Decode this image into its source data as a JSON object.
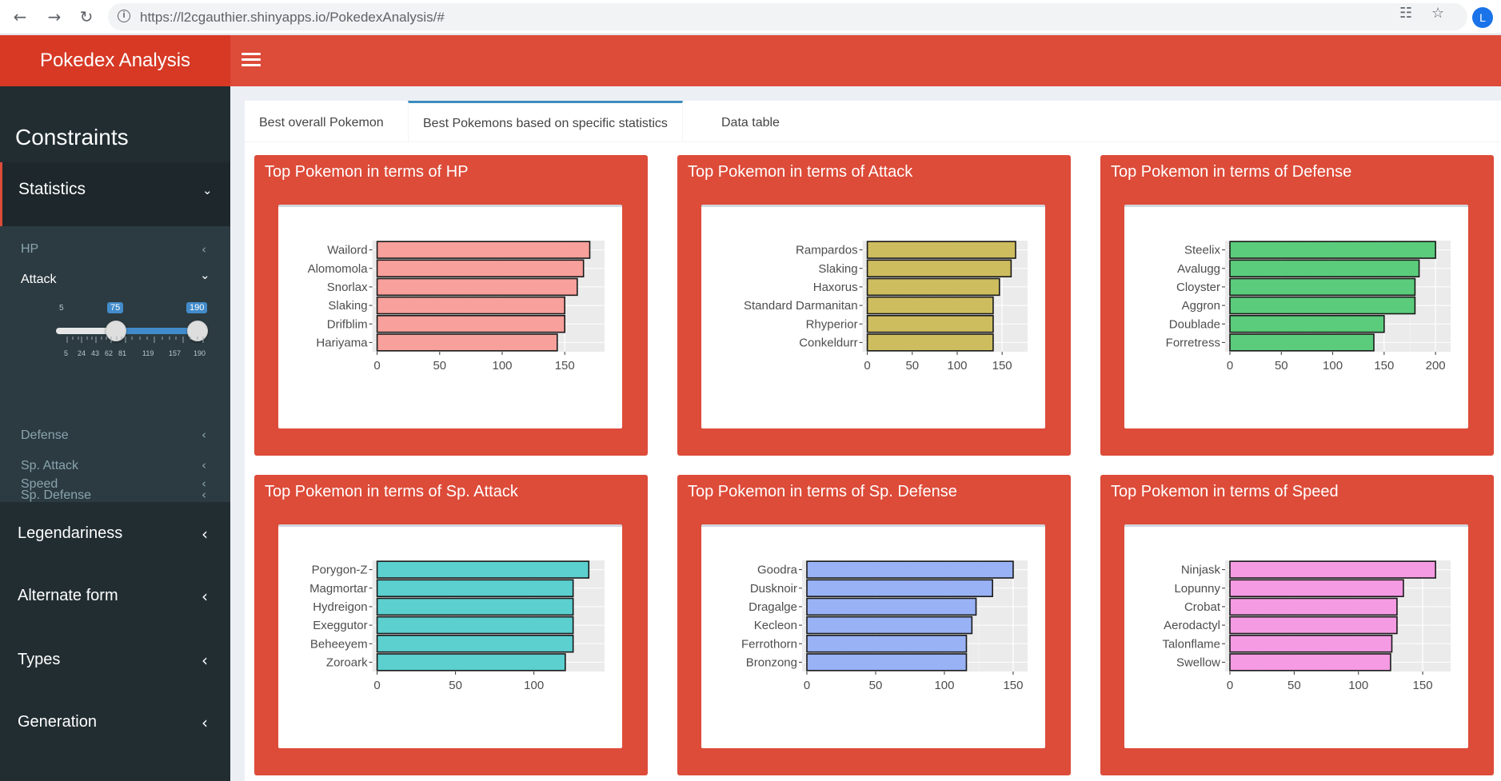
{
  "browser": {
    "url": "https://l2cgauthier.shinyapps.io/PokedexAnalysis/#",
    "back_icon": "arrow-left-icon",
    "forward_icon": "arrow-right-icon",
    "reload_icon": "reload-icon",
    "profile_initial": "L"
  },
  "header": {
    "title": "Pokedex Analysis",
    "color": "#dd4b39",
    "logo_color": "#d73925"
  },
  "sidebar": {
    "title": "Constraints",
    "statistics_label": "Statistics",
    "sub_items": [
      {
        "label": "HP",
        "expanded": false
      },
      {
        "label": "Attack",
        "expanded": true
      },
      {
        "label": "Defense",
        "expanded": false
      },
      {
        "label": "Sp. Attack",
        "expanded": false
      },
      {
        "label": "Sp. Defense",
        "expanded": false
      },
      {
        "label": "Speed",
        "expanded": false
      }
    ],
    "slider": {
      "min": "5",
      "low_value": "75",
      "high_value": "190",
      "tick_labels": [
        "5",
        "24",
        "43",
        "62",
        "81",
        "119",
        "157",
        "190"
      ]
    },
    "items": [
      {
        "label": "Legendariness"
      },
      {
        "label": "Alternate form"
      },
      {
        "label": "Types"
      },
      {
        "label": "Generation"
      }
    ]
  },
  "tabs": [
    {
      "label": "Best overall Pokemon",
      "active": false
    },
    {
      "label": "Best Pokemons based on specific statistics",
      "active": true
    },
    {
      "label": "Data table",
      "active": false
    }
  ],
  "chart_data": [
    {
      "type": "bar",
      "title": "Top Pokemon in terms of HP",
      "categories": [
        "Wailord",
        "Alomomola",
        "Snorlax",
        "Slaking",
        "Drifblim",
        "Hariyama"
      ],
      "values": [
        170,
        165,
        160,
        150,
        150,
        144
      ],
      "xticks": [
        0,
        50,
        100,
        150
      ],
      "xlim": [
        0,
        178
      ],
      "color": "#f8a09b",
      "xlabel": "",
      "ylabel": "",
      "grid": true
    },
    {
      "type": "bar",
      "title": "Top Pokemon in terms of Attack",
      "categories": [
        "Rampardos",
        "Slaking",
        "Haxorus",
        "Standard Darmanitan",
        "Rhyperior",
        "Conkeldurr"
      ],
      "values": [
        165,
        160,
        147,
        140,
        140,
        140
      ],
      "xticks": [
        0,
        50,
        100,
        150
      ],
      "xlim": [
        0,
        173
      ],
      "color": "#cdbd5f",
      "xlabel": "",
      "ylabel": "",
      "grid": true
    },
    {
      "type": "bar",
      "title": "Top Pokemon in terms of Defense",
      "categories": [
        "Steelix",
        "Avalugg",
        "Cloyster",
        "Aggron",
        "Doublade",
        "Forretress"
      ],
      "values": [
        200,
        184,
        180,
        180,
        150,
        140
      ],
      "xticks": [
        0,
        50,
        100,
        150,
        200
      ],
      "xlim": [
        0,
        210
      ],
      "color": "#5bcc7b",
      "xlabel": "",
      "ylabel": "",
      "grid": true
    },
    {
      "type": "bar",
      "title": "Top Pokemon in terms of Sp. Attack",
      "categories": [
        "Porygon-Z",
        "Magmortar",
        "Hydreigon",
        "Exeggutor",
        "Beheeyem",
        "Zoroark"
      ],
      "values": [
        135,
        125,
        125,
        125,
        125,
        120
      ],
      "xticks": [
        0,
        50,
        100
      ],
      "xlim": [
        0,
        142
      ],
      "color": "#5ccfcf",
      "xlabel": "",
      "ylabel": "",
      "grid": true
    },
    {
      "type": "bar",
      "title": "Top Pokemon in terms of Sp. Defense",
      "categories": [
        "Goodra",
        "Dusknoir",
        "Dragalge",
        "Kecleon",
        "Ferrothorn",
        "Bronzong"
      ],
      "values": [
        150,
        135,
        123,
        120,
        116,
        116
      ],
      "xticks": [
        0,
        50,
        100,
        150
      ],
      "xlim": [
        0,
        157
      ],
      "color": "#99b2f5",
      "xlabel": "",
      "ylabel": "",
      "grid": true
    },
    {
      "type": "bar",
      "title": "Top Pokemon in terms of Speed",
      "categories": [
        "Ninjask",
        "Lopunny",
        "Crobat",
        "Aerodactyl",
        "Talonflame",
        "Swellow"
      ],
      "values": [
        160,
        135,
        130,
        130,
        126,
        125
      ],
      "xticks": [
        0,
        50,
        100,
        150
      ],
      "xlim": [
        0,
        168
      ],
      "color": "#f59be4",
      "xlabel": "",
      "ylabel": "",
      "grid": true
    }
  ]
}
